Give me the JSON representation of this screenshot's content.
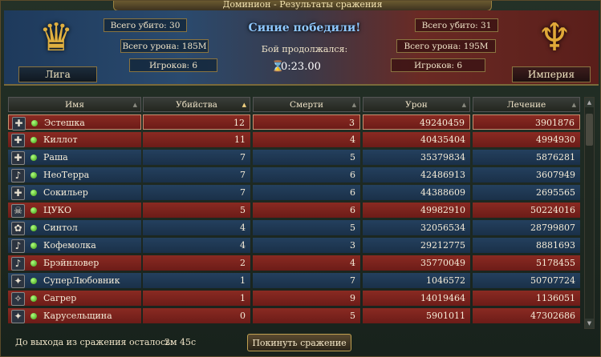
{
  "window": {
    "title": "Доминион - Результаты сражения"
  },
  "summary": {
    "left": {
      "name": "Лига",
      "kills": "Всего убито: 30",
      "damage": "Всего урона: 185M",
      "players": "Игроков: 6"
    },
    "right": {
      "name": "Империя",
      "kills": "Всего убито: 31",
      "damage": "Всего урона: 195M",
      "players": "Игроков: 6"
    },
    "result": "Синие победили!",
    "duration_label": "Бой продолжался:",
    "duration": "0:23.00"
  },
  "table": {
    "headers": {
      "name": "Имя",
      "kills": "Убийства",
      "deaths": "Смерти",
      "damage": "Урон",
      "healing": "Лечение"
    },
    "rows": [
      {
        "team": "red",
        "icon": "shield-cross-icon",
        "name": "Эстешка",
        "kills": "12",
        "deaths": "3",
        "damage": "49240459",
        "healing": "3901876"
      },
      {
        "team": "red",
        "icon": "shield-cross-icon",
        "name": "Киллот",
        "kills": "11",
        "deaths": "4",
        "damage": "40435404",
        "healing": "4994930"
      },
      {
        "team": "blue",
        "icon": "shield-cross-icon",
        "name": "Раша",
        "kills": "7",
        "deaths": "5",
        "damage": "35379834",
        "healing": "5876281"
      },
      {
        "team": "blue",
        "icon": "horn-icon",
        "name": "НеоТерра",
        "kills": "7",
        "deaths": "6",
        "damage": "42486913",
        "healing": "3607949"
      },
      {
        "team": "blue",
        "icon": "shield-cross-icon",
        "name": "Сокильер",
        "kills": "7",
        "deaths": "6",
        "damage": "44388609",
        "healing": "2695565"
      },
      {
        "team": "red",
        "icon": "skull-icon",
        "name": "ЦУКО",
        "kills": "5",
        "deaths": "6",
        "damage": "49982910",
        "healing": "50224016"
      },
      {
        "team": "blue",
        "icon": "paw-icon",
        "name": "Синтол",
        "kills": "4",
        "deaths": "5",
        "damage": "32056534",
        "healing": "28799807"
      },
      {
        "team": "blue",
        "icon": "horn-icon",
        "name": "Кофемолка",
        "kills": "4",
        "deaths": "3",
        "damage": "29212775",
        "healing": "8881693"
      },
      {
        "team": "red",
        "icon": "horn-icon",
        "name": "Брэйнловер",
        "kills": "2",
        "deaths": "4",
        "damage": "35770049",
        "healing": "5178455"
      },
      {
        "team": "blue",
        "icon": "star-icon",
        "name": "СуперЛюбовник",
        "kills": "1",
        "deaths": "7",
        "damage": "1046572",
        "healing": "50707724"
      },
      {
        "team": "red",
        "icon": "wand-icon",
        "name": "Сагрер",
        "kills": "1",
        "deaths": "9",
        "damage": "14019464",
        "healing": "1136051"
      },
      {
        "team": "red",
        "icon": "star-icon",
        "name": "Карусельщина",
        "kills": "0",
        "deaths": "5",
        "damage": "5901011",
        "healing": "47302686"
      }
    ]
  },
  "footer": {
    "leave_label": "До выхода из сражения осталось:",
    "leave_time": "2м 45с",
    "leave_button": "Покинуть сражение"
  }
}
